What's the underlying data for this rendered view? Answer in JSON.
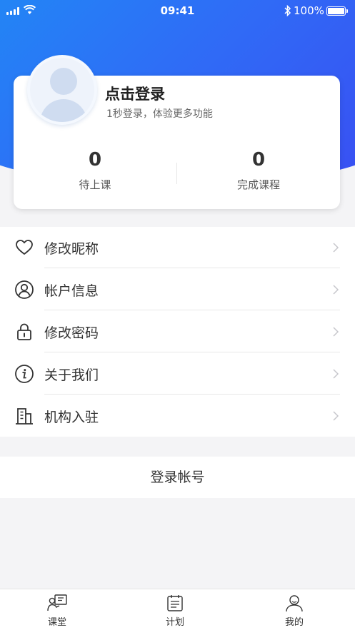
{
  "status_bar": {
    "time": "09:41",
    "battery": "100%"
  },
  "profile": {
    "login_title": "点击登录",
    "login_subtitle": "1秒登录，体验更多功能",
    "stats": [
      {
        "value": "0",
        "label": "待上课"
      },
      {
        "value": "0",
        "label": "完成课程"
      }
    ]
  },
  "menu": {
    "items": [
      {
        "label": "修改昵称",
        "icon": "heart-icon"
      },
      {
        "label": "帐户信息",
        "icon": "user-circle-icon"
      },
      {
        "label": "修改密码",
        "icon": "lock-icon"
      },
      {
        "label": "关于我们",
        "icon": "info-icon"
      },
      {
        "label": "机构入驻",
        "icon": "building-icon"
      }
    ]
  },
  "logout_label": "登录帐号",
  "tabbar": {
    "items": [
      {
        "label": "课堂",
        "icon": "classroom-icon"
      },
      {
        "label": "计划",
        "icon": "calendar-icon"
      },
      {
        "label": "我的",
        "icon": "profile-icon"
      }
    ]
  },
  "colors": {
    "gradient_start": "#1f8cf5",
    "gradient_end": "#3a4df2",
    "background": "#f4f4f6"
  }
}
